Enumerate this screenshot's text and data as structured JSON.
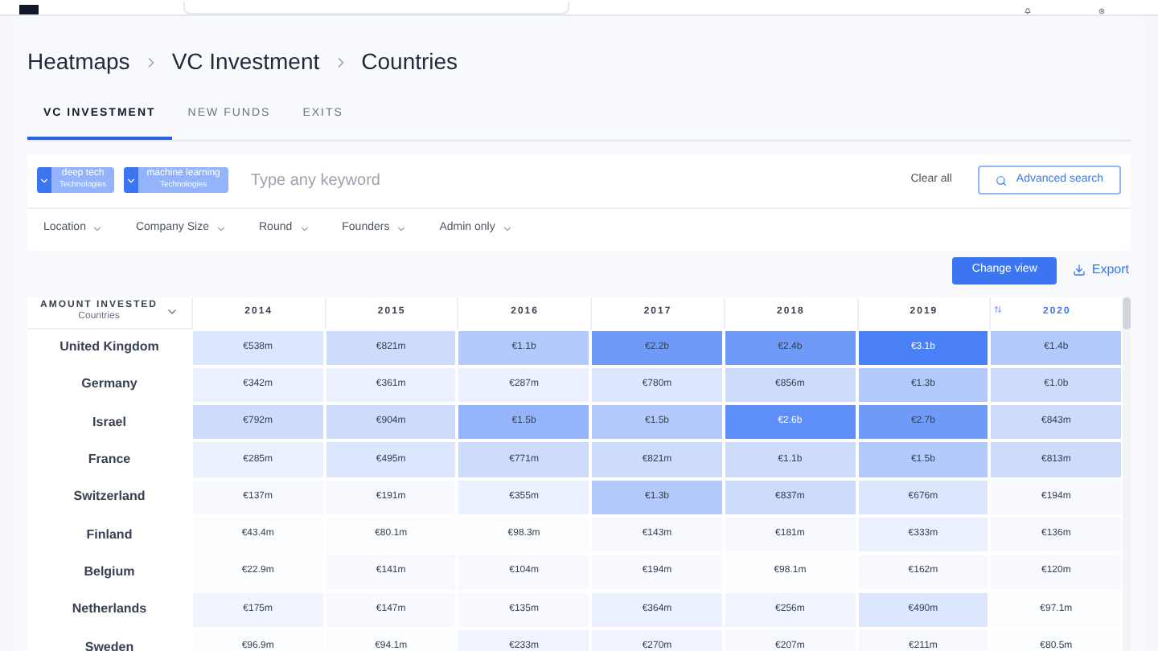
{
  "breadcrumb": [
    "Heatmaps",
    "VC Investment",
    "Countries"
  ],
  "tabs": [
    {
      "label": "VC INVESTMENT",
      "selected": true
    },
    {
      "label": "NEW FUNDS",
      "selected": false
    },
    {
      "label": "EXITS",
      "selected": false
    }
  ],
  "search": {
    "tags": [
      {
        "label": "deep tech",
        "category": "Technologies"
      },
      {
        "label": "machine learning",
        "category": "Technologies"
      }
    ],
    "placeholder": "Type any keyword",
    "clear": "Clear all",
    "advanced": "Advanced search"
  },
  "filters": [
    "Location",
    "Company Size",
    "Round",
    "Founders",
    "Admin only"
  ],
  "actions": {
    "change_view": "Change view",
    "export": "Export"
  },
  "table": {
    "header_title": "AMOUNT INVESTED",
    "header_subtitle": "Countries",
    "columns": [
      {
        "label": "2014",
        "sorted": false
      },
      {
        "label": "2015",
        "sorted": false
      },
      {
        "label": "2016",
        "sorted": false
      },
      {
        "label": "2017",
        "sorted": false
      },
      {
        "label": "2018",
        "sorted": false
      },
      {
        "label": "2019",
        "sorted": false
      },
      {
        "label": "2020",
        "sorted": true
      }
    ],
    "rows": [
      {
        "name": "United Kingdom",
        "cells": [
          {
            "value": "€538m",
            "color": "#dce7fe"
          },
          {
            "value": "€821m",
            "color": "#cddcfd"
          },
          {
            "value": "€1.1b",
            "color": "#b2cafc"
          },
          {
            "value": "€2.2b",
            "color": "#6f9af8"
          },
          {
            "value": "€2.4b",
            "color": "#6f9af8"
          },
          {
            "value": "€3.1b",
            "color": "#4a80f5"
          },
          {
            "value": "€1.4b",
            "color": "#b2cafc"
          }
        ]
      },
      {
        "name": "Germany",
        "cells": [
          {
            "value": "€342m",
            "color": "#ebf1ff"
          },
          {
            "value": "€361m",
            "color": "#ebf1ff"
          },
          {
            "value": "€287m",
            "color": "#ebf1ff"
          },
          {
            "value": "€780m",
            "color": "#dce7fe"
          },
          {
            "value": "€856m",
            "color": "#cddcfd"
          },
          {
            "value": "€1.3b",
            "color": "#b2cafc"
          },
          {
            "value": "€1.0b",
            "color": "#cddcfd"
          }
        ]
      },
      {
        "name": "Israel",
        "cells": [
          {
            "value": "€792m",
            "color": "#cddcfd"
          },
          {
            "value": "€904m",
            "color": "#cddcfd"
          },
          {
            "value": "€1.5b",
            "color": "#94b5fb"
          },
          {
            "value": "€1.5b",
            "color": "#b2cafc"
          },
          {
            "value": "€2.6b",
            "color": "#5e8ef7"
          },
          {
            "value": "€2.7b",
            "color": "#6f9af8"
          },
          {
            "value": "€843m",
            "color": "#cddcfd"
          }
        ]
      },
      {
        "name": "France",
        "cells": [
          {
            "value": "€285m",
            "color": "#ebf1ff"
          },
          {
            "value": "€495m",
            "color": "#dce7fe"
          },
          {
            "value": "€771m",
            "color": "#cddcfd"
          },
          {
            "value": "€821m",
            "color": "#cddcfd"
          },
          {
            "value": "€1.1b",
            "color": "#cddcfd"
          },
          {
            "value": "€1.5b",
            "color": "#b2cafc"
          },
          {
            "value": "€813m",
            "color": "#cddcfd"
          }
        ]
      },
      {
        "name": "Switzerland",
        "cells": [
          {
            "value": "€137m",
            "color": "#f7f9ff"
          },
          {
            "value": "€191m",
            "color": "#f7f9ff"
          },
          {
            "value": "€355m",
            "color": "#ebf1ff"
          },
          {
            "value": "€1.3b",
            "color": "#b2cafc"
          },
          {
            "value": "€837m",
            "color": "#cddcfd"
          },
          {
            "value": "€676m",
            "color": "#dce7fe"
          },
          {
            "value": "€194m",
            "color": "#f7f9ff"
          }
        ]
      },
      {
        "name": "Finland",
        "cells": [
          {
            "value": "€43.4m",
            "color": "#fcfdff"
          },
          {
            "value": "€80.1m",
            "color": "#fcfdff"
          },
          {
            "value": "€98.3m",
            "color": "#fcfdff"
          },
          {
            "value": "€143m",
            "color": "#f7f9ff"
          },
          {
            "value": "€181m",
            "color": "#f7f9ff"
          },
          {
            "value": "€333m",
            "color": "#ebf1ff"
          },
          {
            "value": "€136m",
            "color": "#f7f9ff"
          }
        ]
      },
      {
        "name": "Belgium",
        "cells": [
          {
            "value": "€22.9m",
            "color": "#fcfdff"
          },
          {
            "value": "€141m",
            "color": "#f7f9ff"
          },
          {
            "value": "€104m",
            "color": "#f7f9ff"
          },
          {
            "value": "€194m",
            "color": "#f7f9ff"
          },
          {
            "value": "€98.1m",
            "color": "#fcfdff"
          },
          {
            "value": "€162m",
            "color": "#f7f9ff"
          },
          {
            "value": "€120m",
            "color": "#f7f9ff"
          }
        ]
      },
      {
        "name": "Netherlands",
        "cells": [
          {
            "value": "€175m",
            "color": "#f0f4ff"
          },
          {
            "value": "€147m",
            "color": "#f7f9ff"
          },
          {
            "value": "€135m",
            "color": "#f7f9ff"
          },
          {
            "value": "€364m",
            "color": "#ebf1ff"
          },
          {
            "value": "€256m",
            "color": "#f0f4ff"
          },
          {
            "value": "€490m",
            "color": "#dce7fe"
          },
          {
            "value": "€97.1m",
            "color": "#fcfdff"
          }
        ]
      },
      {
        "name": "Sweden",
        "cells": [
          {
            "value": "€96.9m",
            "color": "#fcfdff"
          },
          {
            "value": "€94.1m",
            "color": "#fcfdff"
          },
          {
            "value": "€233m",
            "color": "#f0f4ff"
          },
          {
            "value": "€270m",
            "color": "#f0f4ff"
          },
          {
            "value": "€207m",
            "color": "#f7f9ff"
          },
          {
            "value": "€211m",
            "color": "#f7f9ff"
          },
          {
            "value": "€80.5m",
            "color": "#fcfdff"
          }
        ]
      }
    ]
  }
}
